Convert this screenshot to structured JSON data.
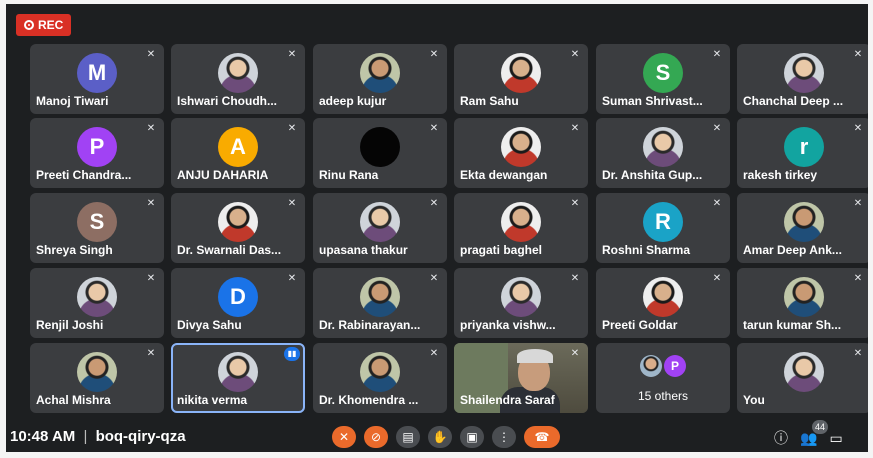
{
  "rec_label": "REC",
  "participants": [
    {
      "name": "Manoj Tiwari",
      "initial": "M",
      "color": "#5b5fc7",
      "type": "initial"
    },
    {
      "name": "Ishwari Choudh...",
      "type": "photo"
    },
    {
      "name": "adeep kujur",
      "type": "photo3"
    },
    {
      "name": "Ram Sahu",
      "type": "photo2"
    },
    {
      "name": "Suman Shrivast...",
      "initial": "S",
      "color": "#34a853",
      "type": "initial"
    },
    {
      "name": "Chanchal Deep ...",
      "type": "photo"
    },
    {
      "name": "Preeti Chandra...",
      "initial": "P",
      "color": "#a142f4",
      "type": "initial"
    },
    {
      "name": "ANJU DAHARIA",
      "initial": "A",
      "color": "#f9ab00",
      "type": "initial"
    },
    {
      "name": "Rinu Rana",
      "type": "black"
    },
    {
      "name": "Ekta dewangan",
      "type": "photo2"
    },
    {
      "name": "Dr. Anshita Gup...",
      "type": "photo"
    },
    {
      "name": "rakesh tirkey",
      "initial": "r",
      "color": "#12a4a0",
      "type": "initial"
    },
    {
      "name": "Shreya Singh",
      "initial": "S",
      "color": "#8d6e63",
      "type": "initial"
    },
    {
      "name": "Dr. Swarnali Das...",
      "type": "photo2"
    },
    {
      "name": "upasana thakur",
      "type": "photo"
    },
    {
      "name": "pragati baghel",
      "type": "photo2"
    },
    {
      "name": "Roshni Sharma",
      "initial": "R",
      "color": "#1aa3c7",
      "type": "initial"
    },
    {
      "name": "Amar Deep Ank...",
      "type": "photo3"
    },
    {
      "name": "Renjil Joshi",
      "type": "photo"
    },
    {
      "name": "Divya Sahu",
      "initial": "D",
      "color": "#1a73e8",
      "type": "initial"
    },
    {
      "name": "Dr. Rabinarayan...",
      "type": "photo3"
    },
    {
      "name": "priyanka vishw...",
      "type": "photo"
    },
    {
      "name": "Preeti Goldar",
      "type": "photo2"
    },
    {
      "name": "tarun kumar Sh...",
      "type": "photo3"
    },
    {
      "name": "Achal Mishra",
      "type": "photo3"
    },
    {
      "name": "nikita verma",
      "type": "photo",
      "active": true
    },
    {
      "name": "Dr. Khomendra ...",
      "type": "photo3"
    },
    {
      "name": "Shailendra Saraf",
      "type": "video"
    },
    {
      "name": "15 others",
      "type": "others",
      "others_initial": "P"
    },
    {
      "name": "You",
      "type": "photo"
    }
  ],
  "bottom_bar": {
    "time": "10:48 AM",
    "separator": "|",
    "meeting_code": "boq-qiry-qza",
    "participant_count": "44"
  }
}
